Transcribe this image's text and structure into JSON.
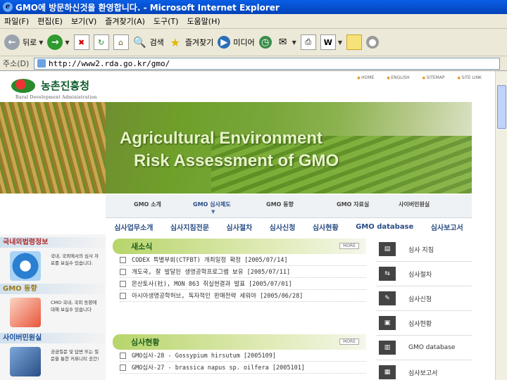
{
  "window": {
    "title": "GMO에 방문하신것을 환영합니다. - Microsoft Internet Explorer"
  },
  "menu": [
    "파일(F)",
    "편집(E)",
    "보기(V)",
    "즐겨찾기(A)",
    "도구(T)",
    "도움말(H)"
  ],
  "toolbar": {
    "back_label": "뒤로",
    "search_label": "검색",
    "favorites_label": "즐겨찾기",
    "media_label": "미디어"
  },
  "address": {
    "label": "주소(D)",
    "url": "http://www2.rda.go.kr/gmo/"
  },
  "site": {
    "logo_text": "농촌진흥청",
    "logo_sub": "Rural Development Administration",
    "top_links": [
      "HOME",
      "ENGLISH",
      "SITEMAP",
      "SITE LINK"
    ],
    "banner_line1": "Agricultural Environment",
    "banner_line2": "Risk Assessment of GMO"
  },
  "nav_main": [
    "GMO 소개",
    "GMO 심사제도",
    "GMO 동향",
    "GMO 자료실",
    "사이버민원실"
  ],
  "nav_sub": [
    "심사업무소개",
    "심사지침전문",
    "심사절차",
    "심사신청",
    "심사현황",
    "GMO database",
    "심사보고서"
  ],
  "left": {
    "sections": [
      {
        "title": "국내외법령정보",
        "text": "국내, 국외에서의 심사 자료를 보실수 있습니다."
      },
      {
        "title": "GMO 동향",
        "text": "CMO 국내, 국외 동향에 대해 보실수 있습니다"
      },
      {
        "title": "사이버민원실",
        "text": "궁금질문 및 답변 또는 질문을 통한 커뮤니티 공간!"
      }
    ]
  },
  "news": {
    "title": "새소식",
    "more": "MORE",
    "items": [
      "CODEX 특별부회(CTFBT) 개최일정 확정 [2005/07/14]",
      "개도국, 잘 발달된 생명공학프로그램 보유 [2005/07/11]",
      "몬산토사(社), MON 863 취실현결과 발표 [2005/07/01]",
      "아시아생명공학허브, 독자적인 판매전략 세워야 [2005/06/28]"
    ]
  },
  "status": {
    "title": "심사현황",
    "more": "MORE",
    "items": [
      "GMO심사-28 - Gossypium hirsutum [2005109]",
      "GMO심사-27 - brassica napus sp. oilfera [2005101]"
    ]
  },
  "right_menu": [
    "심사 지침",
    "심사절차",
    "심사신청",
    "심사현황",
    "GMO database",
    "심사보고서"
  ]
}
